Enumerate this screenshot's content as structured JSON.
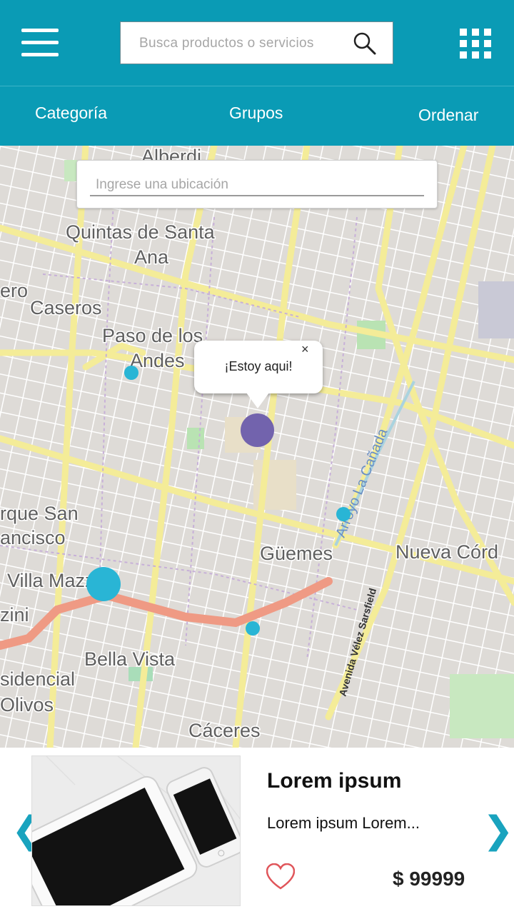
{
  "header": {
    "search_placeholder": "Busca productos o servicios",
    "tabs": [
      {
        "label": "Categoría"
      },
      {
        "label": "Grupos"
      },
      {
        "label": "Ordenar"
      }
    ],
    "bg_color": "#0a9bb5"
  },
  "map": {
    "location_placeholder": "Ingrese una ubicación",
    "popup_text": "¡Estoy aqui!",
    "popup_close": "×",
    "place_labels": [
      "Alberdi",
      "Quintas de Santa",
      "Ana",
      "ero",
      "Caseros",
      "Paso de los",
      "Andes",
      "rque San",
      "ancisco",
      "Villa Mazzzi",
      "zini",
      "Güemes",
      "Nueva Córd",
      "Bella Vista",
      "sidencial",
      "Olivos",
      "Cáceres",
      "Arroyo La Cañada",
      "Avenida Vélez Sarsfield"
    ],
    "marker_color": "#29b5d5",
    "user_marker_color": "#7263ad"
  },
  "card": {
    "title": "Lorem ipsum",
    "description": "Lorem ipsum Lorem...",
    "price": "$ 99999",
    "prev_icon": "❮",
    "next_icon": "❯",
    "accent_color": "#19a3be",
    "heart_color": "#e0555a"
  }
}
